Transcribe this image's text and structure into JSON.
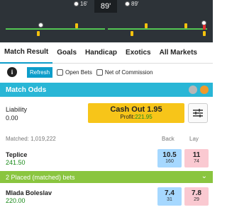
{
  "timeline": {
    "clock": "89'",
    "goal_left": "16'",
    "goal_right": "89'"
  },
  "tabs": [
    {
      "label": "Match Result"
    },
    {
      "label": "Goals"
    },
    {
      "label": "Handicap"
    },
    {
      "label": "Exotics"
    },
    {
      "label": "All Markets"
    }
  ],
  "toolbar": {
    "refresh_label": "Refresh",
    "open_bets_label": "Open Bets",
    "net_commission_label": "Net of Commission"
  },
  "market": {
    "title": "Match Odds",
    "liability_label": "Liability",
    "liability_value": "0.00",
    "cashout_label": "Cash Out 1.95",
    "profit_label": "Profit:",
    "profit_value": "221.95",
    "matched": "Matched: 1,019,222",
    "back_label": "Back",
    "lay_label": "Lay"
  },
  "runners": [
    {
      "name": "Teplice",
      "position": "241.50",
      "back_price": "10.5",
      "back_size": "160",
      "lay_price": "11",
      "lay_size": "74"
    },
    {
      "name": "Mlada Boleslav",
      "position": "220.00",
      "back_price": "7.4",
      "back_size": "31",
      "lay_price": "7.8",
      "lay_size": "29"
    }
  ],
  "placed_bets": {
    "label": "2 Placed (matched) bets"
  },
  "colors": {
    "accent": "#29b6d6",
    "back": "#a6d8ff",
    "lay": "#fac9d1",
    "cashout": "#f7c519",
    "placed": "#8ac53f"
  }
}
